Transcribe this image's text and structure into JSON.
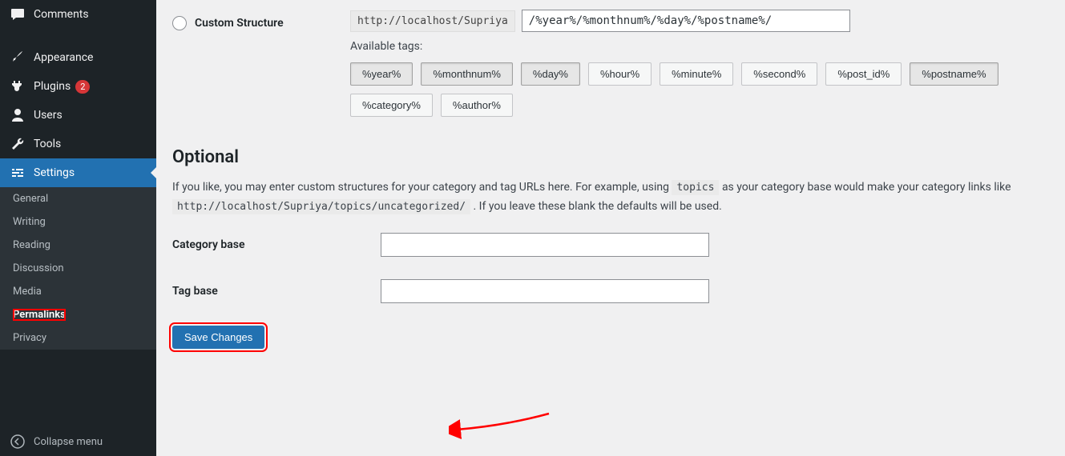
{
  "sidebar": {
    "items": [
      {
        "label": "Comments",
        "icon": "comment"
      },
      {
        "label": "Appearance",
        "icon": "brush"
      },
      {
        "label": "Plugins",
        "icon": "plug",
        "badge": "2"
      },
      {
        "label": "Users",
        "icon": "user"
      },
      {
        "label": "Tools",
        "icon": "wrench"
      },
      {
        "label": "Settings",
        "icon": "sliders",
        "active": true
      }
    ],
    "submenu": [
      {
        "label": "General"
      },
      {
        "label": "Writing"
      },
      {
        "label": "Reading"
      },
      {
        "label": "Discussion"
      },
      {
        "label": "Media"
      },
      {
        "label": "Permalinks",
        "current": true,
        "highlight": true
      },
      {
        "label": "Privacy"
      }
    ],
    "collapse": "Collapse menu"
  },
  "custom": {
    "label": "Custom Structure",
    "base_url": "http://localhost/Supriya",
    "structure_value": "/%year%/%monthnum%/%day%/%postname%/",
    "available_label": "Available tags:",
    "tags": [
      "%year%",
      "%monthnum%",
      "%day%",
      "%hour%",
      "%minute%",
      "%second%",
      "%post_id%",
      "%postname%",
      "%category%",
      "%author%"
    ],
    "active_tags": [
      "%year%",
      "%monthnum%",
      "%day%",
      "%postname%"
    ]
  },
  "optional": {
    "heading": "Optional",
    "desc_1": "If you like, you may enter custom structures for your category and tag URLs here. For example, using ",
    "desc_code1": "topics",
    "desc_2": " as your category base would make your category links like ",
    "desc_code2": "http://localhost/Supriya/topics/uncategorized/",
    "desc_3": " . If you leave these blank the defaults will be used.",
    "category_label": "Category base",
    "tag_label": "Tag base"
  },
  "save_label": "Save Changes"
}
